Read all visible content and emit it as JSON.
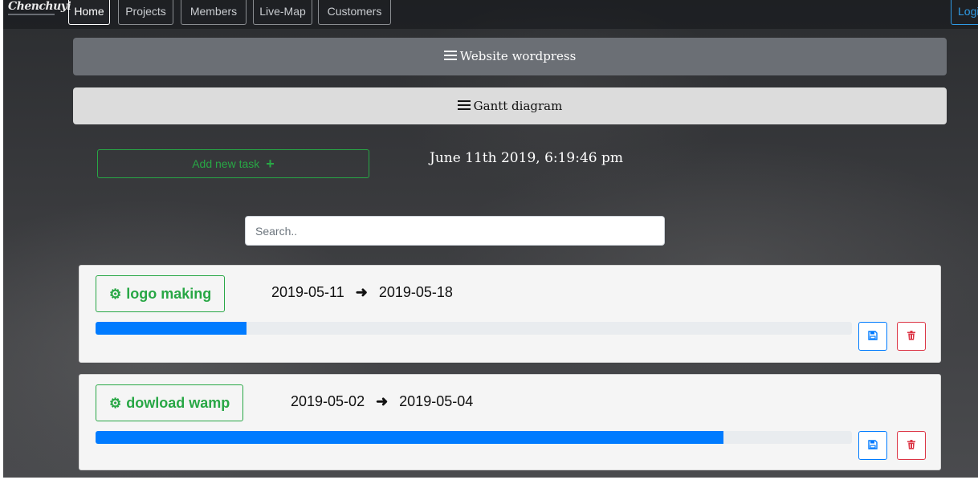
{
  "brand": {
    "logo_text": "Chenchuyi"
  },
  "nav": {
    "tabs": [
      "Home",
      "Projects",
      "Members",
      "Live-Map",
      "Customers"
    ],
    "active": "Home",
    "login_label": "Login"
  },
  "project": {
    "title": "Website wordpress",
    "icon": "bars-icon"
  },
  "gantt": {
    "label": "Gantt diagram",
    "icon": "bars-icon"
  },
  "toolbar": {
    "add_task_label": "Add new task",
    "add_icon": "plus-icon"
  },
  "datetime": "June 11th 2019, 6:19:46 pm",
  "search": {
    "placeholder": "Search..",
    "value": ""
  },
  "tasks": [
    {
      "name": "logo making",
      "start": "2019-05-11",
      "end": "2019-05-18",
      "progress": 0.2
    },
    {
      "name": "dowload wamp",
      "start": "2019-05-02",
      "end": "2019-05-04",
      "progress": 0.83
    }
  ],
  "colors": {
    "accent_green": "#28a745",
    "progress_blue": "#007bff",
    "danger_red": "#dc3545",
    "project_bar": "#6b6f75",
    "gantt_bar": "#dcdcdc"
  }
}
